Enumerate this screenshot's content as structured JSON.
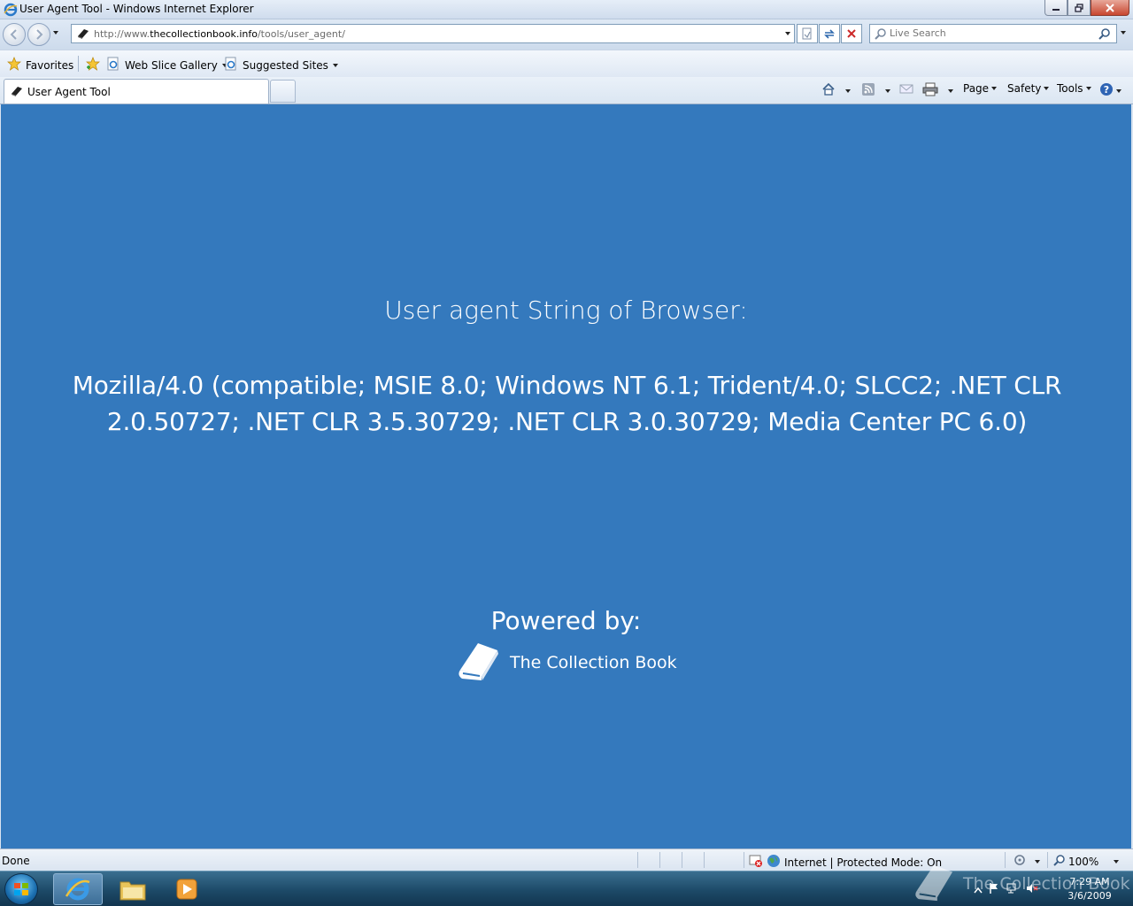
{
  "window": {
    "title": "User Agent Tool - Windows Internet Explorer"
  },
  "address": {
    "url_prefix": "http://www.",
    "url_domain": "thecollectionbook.info",
    "url_path": "/tools/user_agent/"
  },
  "search": {
    "placeholder": "Live Search"
  },
  "favorites": {
    "favorites_label": "Favorites",
    "items": [
      {
        "label": "Web Slice Gallery"
      },
      {
        "label": "Suggested Sites"
      }
    ]
  },
  "tabs": [
    {
      "label": "User Agent Tool"
    }
  ],
  "commandbar": {
    "page": "Page",
    "safety": "Safety",
    "tools": "Tools"
  },
  "content": {
    "heading": "User agent String of Browser:",
    "user_agent": "Mozilla/4.0 (compatible; MSIE 8.0; Windows NT 6.1; Trident/4.0; SLCC2; .NET CLR 2.0.50727; .NET CLR 3.5.30729; .NET CLR 3.0.30729; Media Center PC 6.0)",
    "powered_by": "Powered by:",
    "brand": "The Collection Book",
    "background_color": "#3479bd"
  },
  "status": {
    "text": "Done",
    "zone": "Internet | Protected Mode: On",
    "zoom": "100%"
  },
  "taskbar": {
    "time": "7:29 AM",
    "date": "3/6/2009"
  },
  "watermark": {
    "text": "The Collection Book"
  }
}
